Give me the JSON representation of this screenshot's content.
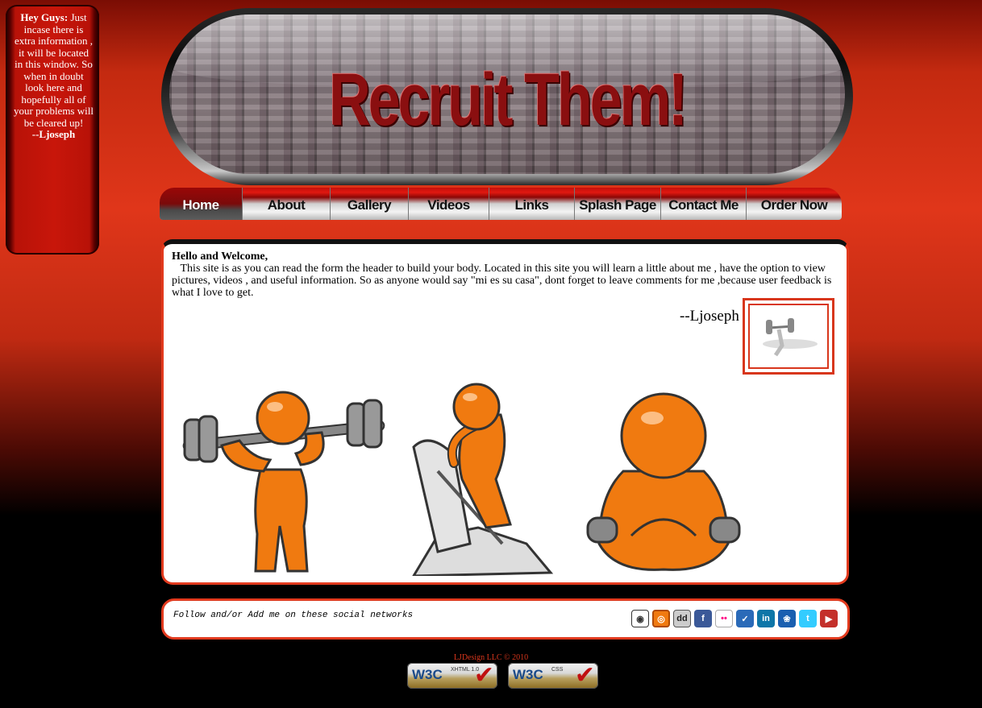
{
  "sidenote": {
    "lead": "Hey Guys:",
    "body": " Just incase there is extra information , it will be located in this window. So when in doubt look here and hopefully all of your problems will be cleared up!",
    "sign": "--Ljoseph"
  },
  "header": {
    "title": "Recruit Them!"
  },
  "nav": {
    "items": [
      {
        "label": "Home"
      },
      {
        "label": "About"
      },
      {
        "label": "Gallery"
      },
      {
        "label": "Videos"
      },
      {
        "label": "Links"
      },
      {
        "label": "Splash Page"
      },
      {
        "label": "Contact Me"
      },
      {
        "label": "Order Now"
      }
    ],
    "active": "Home"
  },
  "content": {
    "heading": "Hello and Welcome,",
    "paragraph": "This site is as you can read the form the header to build your body. Located in this site you will learn a little about me , have the option to view pictures, videos , and useful information. So as anyone would say \"mi es su casa\", dont forget to leave comments for me ,because user feedback is what I love to get.",
    "signature": "--Ljoseph"
  },
  "social": {
    "text": "Follow and/or Add me on these social networks",
    "icons": [
      "myspace-icon",
      "rss-icon",
      "delicious-icon",
      "facebook-icon",
      "flickr-icon",
      "technorati-icon",
      "linkedin-icon",
      "msn-icon",
      "twitter-icon",
      "youtube-icon"
    ]
  },
  "footer": {
    "copyright": "LJDesign LLC © 2010",
    "badges": [
      {
        "w3": "W3C",
        "sub": "XHTML 1.0"
      },
      {
        "w3": "W3C",
        "sub": "CSS"
      }
    ]
  },
  "colors": {
    "accent_red": "#e23a1e",
    "title_red": "#8a0f10",
    "figure_orange": "#f07a10"
  }
}
